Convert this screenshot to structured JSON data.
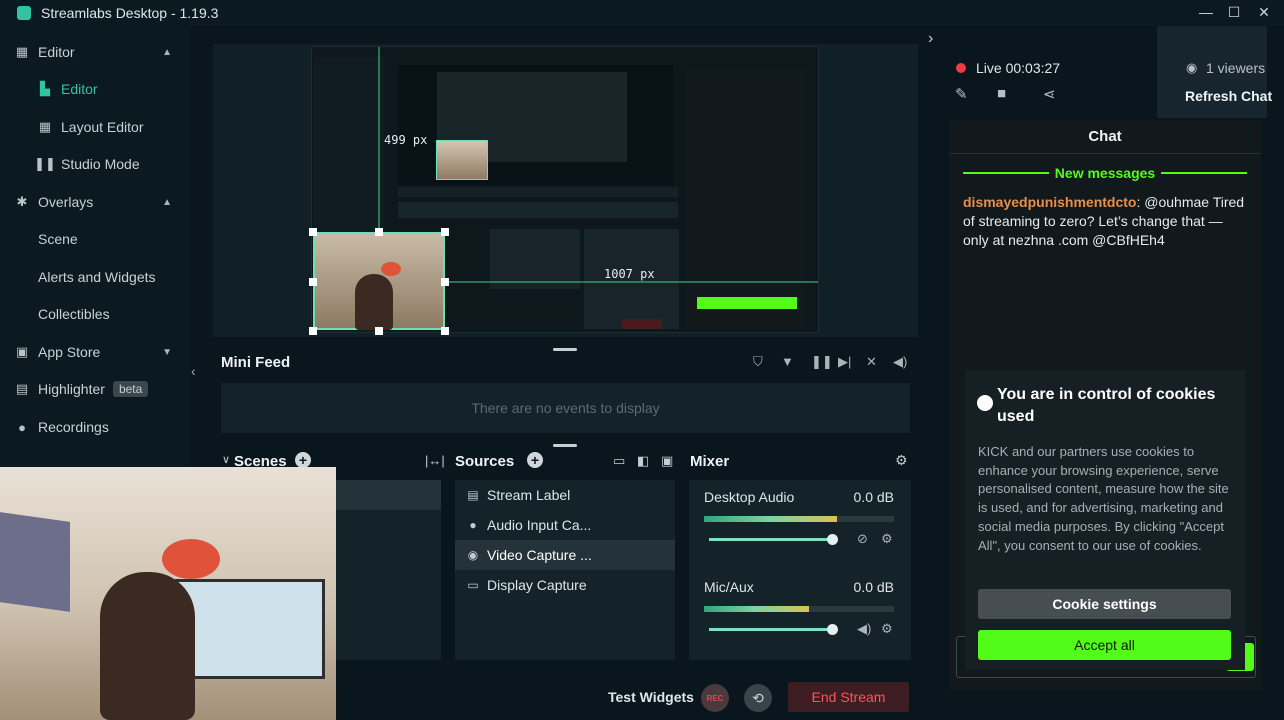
{
  "window": {
    "title": "Streamlabs Desktop - 1.19.3",
    "minimize": "—",
    "maximize": "☐",
    "close": "✕"
  },
  "sidebar": {
    "items": [
      {
        "label": "Editor",
        "icon": "editor-grid-icon",
        "glyph": "▦",
        "caret": "▲"
      },
      {
        "label": "Editor",
        "icon": "editor-icon",
        "glyph": "▙",
        "active": true
      },
      {
        "label": "Layout Editor",
        "icon": "layout-editor-icon",
        "glyph": "▦"
      },
      {
        "label": "Studio Mode",
        "icon": "studio-mode-icon",
        "glyph": "❚❚"
      },
      {
        "label": "Overlays",
        "icon": "overlays-icon",
        "glyph": "✱",
        "caret": "▲"
      },
      {
        "label": "Scene"
      },
      {
        "label": "Alerts and Widgets"
      },
      {
        "label": "Collectibles"
      },
      {
        "label": "App Store",
        "icon": "app-store-icon",
        "glyph": "▣",
        "caret": "▼"
      },
      {
        "label": "Highlighter",
        "icon": "highlighter-icon",
        "glyph": "▤",
        "badge": "beta"
      },
      {
        "label": "Recordings",
        "icon": "recordings-icon",
        "glyph": "●"
      }
    ]
  },
  "preview": {
    "px_width": "499 px",
    "px_height": "1007 px"
  },
  "minifeed": {
    "title": "Mini Feed",
    "empty": "There are no events to display"
  },
  "scenes": {
    "title": "Scenes"
  },
  "sources": {
    "title": "Sources",
    "items": [
      {
        "label": "Stream Label",
        "icon": "text-icon",
        "glyph": "▤"
      },
      {
        "label": "Audio Input Ca...",
        "icon": "microphone-icon",
        "glyph": "🎙"
      },
      {
        "label": "Video Capture ...",
        "icon": "webcam-icon",
        "glyph": "◉",
        "selected": true
      },
      {
        "label": "Display Capture",
        "icon": "monitor-icon",
        "glyph": "▭"
      }
    ]
  },
  "mixer": {
    "title": "Mixer",
    "channels": [
      {
        "name": "Desktop Audio",
        "db": "0.0 dB",
        "level": 0.7
      },
      {
        "name": "Mic/Aux",
        "db": "0.0 dB",
        "level": 0.55
      }
    ]
  },
  "footer": {
    "test_widgets": "Test Widgets",
    "rec": "REC",
    "end_stream": "End Stream"
  },
  "stream": {
    "live": "Live 00:03:27",
    "viewers": "1 viewers",
    "refresh_chat": "Refresh Chat"
  },
  "chat": {
    "title": "Chat",
    "new_messages": "New messages",
    "message": {
      "user": "dismayedpunishmentdcto",
      "text": ": @ouhmae Tired of streaming to zero? Let’s change that — only at nezhna .com @CBfHEh4"
    }
  },
  "cookie": {
    "title": "You are in control of cookies used",
    "body": "KICK and our partners use cookies to enhance your browsing experience, serve personalised content, measure how the site is used, and for advertising, marketing and social media purposes. By clicking \"Accept All\", you consent to our use of cookies.",
    "settings": "Cookie settings",
    "accept": "Accept all"
  },
  "colors": {
    "accent": "#31c3a2",
    "kick_green": "#53fc18",
    "live_red": "#f13b43",
    "end_stream": "#ff525c"
  }
}
